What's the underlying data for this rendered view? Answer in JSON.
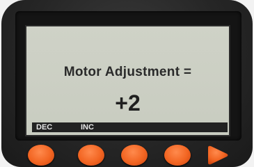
{
  "display": {
    "label": "Motor Adjustment =",
    "value": "+2"
  },
  "softkeys": {
    "key1": "DEC",
    "key2": "INC"
  },
  "colors": {
    "lcd_background": "#cbcfc3",
    "bezel": "#262626",
    "button_orange": "#f26522",
    "softkey_bar": "#222222"
  },
  "icons": [
    "right-arrow-icon"
  ]
}
